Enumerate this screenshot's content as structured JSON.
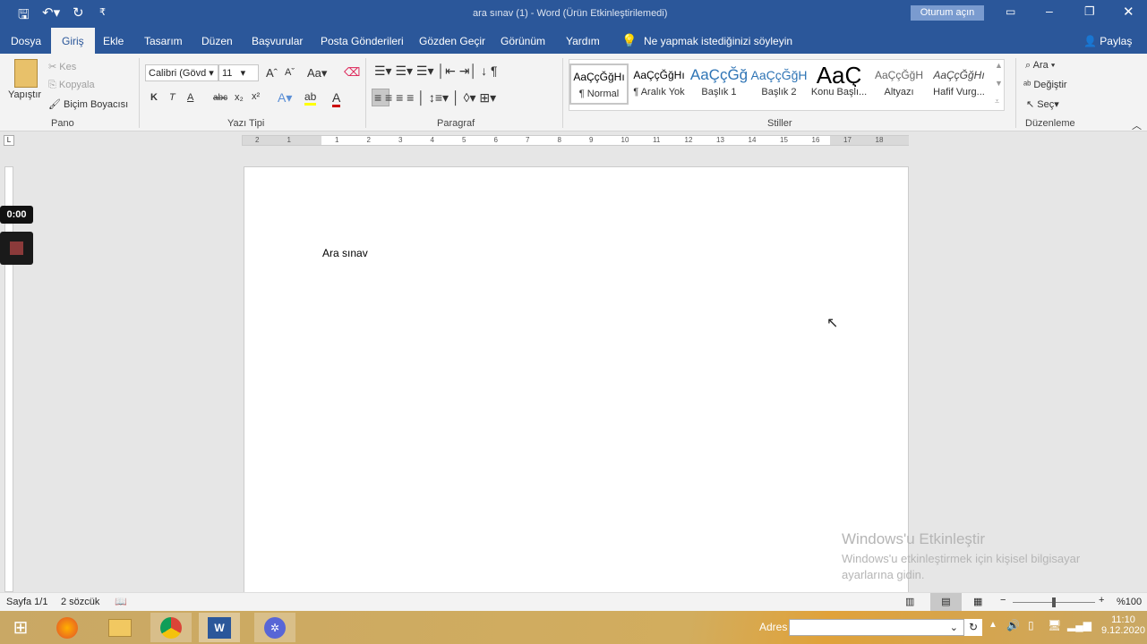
{
  "title": "ara sınav (1)  -  Word (Ürün Etkinleştirilemedi)",
  "signin": "Oturum açın",
  "tabs": [
    "Dosya",
    "Giriş",
    "Ekle",
    "Tasarım",
    "Düzen",
    "Başvurular",
    "Posta Gönderileri",
    "Gözden Geçir",
    "Görünüm",
    "Yardım"
  ],
  "tellme": "Ne yapmak istediğinizi söyleyin",
  "share": "Paylaş",
  "clipboard": {
    "paste": "Yapıştır",
    "cut": "Kes",
    "copy": "Kopyala",
    "painter": "Biçim Boyacısı",
    "label": "Pano"
  },
  "font": {
    "name": "Calibri (Gövd",
    "size": "11",
    "label": "Yazı Tipi",
    "bold": "K",
    "italic": "T",
    "underline": "A",
    "strike": "abc",
    "sub": "x₂",
    "sup": "x²",
    "case": "Aa"
  },
  "paragraph": {
    "label": "Paragraf"
  },
  "styles": {
    "label": "Stiller",
    "items": [
      {
        "preview": "AaÇçĞğHı",
        "name": "¶ Normal"
      },
      {
        "preview": "AaÇçĞğHı",
        "name": "¶ Aralık Yok"
      },
      {
        "preview": "AaÇçĞğ",
        "name": "Başlık 1"
      },
      {
        "preview": "AaÇçĞğH",
        "name": "Başlık 2"
      },
      {
        "preview": "AaÇ",
        "name": "Konu Başlı..."
      },
      {
        "preview": "AaÇçĞğH",
        "name": "Altyazı"
      },
      {
        "preview": "AaÇçĞğHı",
        "name": "Hafif Vurg..."
      }
    ]
  },
  "editing": {
    "find": "Ara",
    "replace": "Değiştir",
    "select": "Seç",
    "label": "Düzenleme"
  },
  "ruler": [
    "2",
    "1",
    "1",
    "2",
    "3",
    "4",
    "5",
    "6",
    "7",
    "8",
    "9",
    "10",
    "11",
    "12",
    "13",
    "14",
    "15",
    "16",
    "17",
    "18"
  ],
  "recorder": {
    "time": "0:00"
  },
  "document": {
    "text": "Ara sınav"
  },
  "status": {
    "page": "Sayfa 1/1",
    "words": "2 sözcük",
    "zoom": "%100"
  },
  "watermark": {
    "title": "Windows'u Etkinleştir",
    "line1": "Windows'u etkinleştirmek için kişisel bilgisayar",
    "line2": "ayarlarına gidin."
  },
  "taskbar": {
    "address_label": "Adres",
    "address_value": "",
    "time": "11:10",
    "date": "9.12.2020"
  }
}
